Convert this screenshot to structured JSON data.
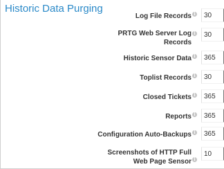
{
  "section": {
    "title": "Historic Data Purging"
  },
  "fields": [
    {
      "label": "Log File Records",
      "value": "30"
    },
    {
      "label": "PRTG Web Server Log Records",
      "value": "30"
    },
    {
      "label": "Historic Sensor Data",
      "value": "365"
    },
    {
      "label": "Toplist Records",
      "value": "30"
    },
    {
      "label": "Closed Tickets",
      "value": "365"
    },
    {
      "label": "Reports",
      "value": "365"
    },
    {
      "label": "Configuration Auto-Backups",
      "value": "365"
    },
    {
      "label": "Screenshots of HTTP Full Web Page Sensor",
      "value": "10"
    }
  ],
  "icons": {
    "info": "info-icon"
  }
}
